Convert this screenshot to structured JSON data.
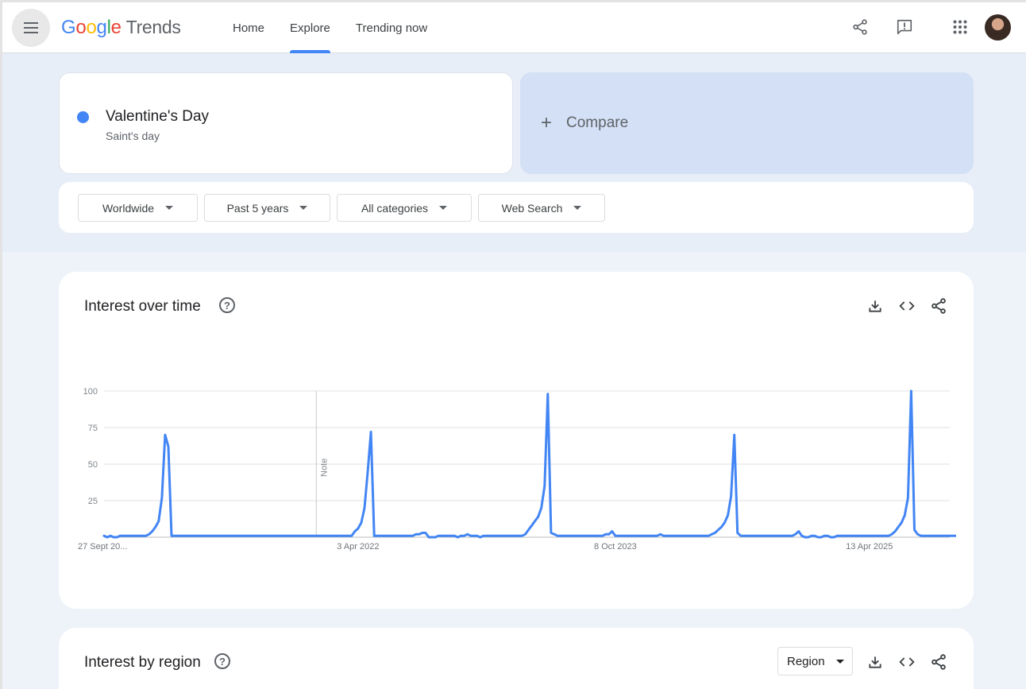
{
  "header": {
    "logo_google": [
      "G",
      "o",
      "o",
      "g",
      "l",
      "e"
    ],
    "logo_trends": "Trends",
    "nav": [
      {
        "label": "Home",
        "active": false
      },
      {
        "label": "Explore",
        "active": true
      },
      {
        "label": "Trending now",
        "active": false
      }
    ]
  },
  "search": {
    "term": "Valentine's Day",
    "term_type": "Saint's day",
    "term_color": "#4285f4",
    "compare_plus": "+",
    "compare_label": "Compare"
  },
  "filters": [
    {
      "label": "Worldwide"
    },
    {
      "label": "Past 5 years"
    },
    {
      "label": "All categories"
    },
    {
      "label": "Web Search"
    }
  ],
  "interest_over_time": {
    "title": "Interest over time",
    "help": "?"
  },
  "interest_by_region": {
    "title": "Interest by region",
    "help": "?",
    "resolution": "Region"
  },
  "chart_data": {
    "type": "line",
    "series_color": "#4285f4",
    "ylim": [
      0,
      100
    ],
    "y_ticks": [
      100,
      75,
      50,
      25
    ],
    "x_tick_labels": [
      "27 Sept 20...",
      "3 Apr 2022",
      "8 Oct 2023",
      "13 Apr 2025"
    ],
    "x_tick_weeks": [
      0,
      79,
      159,
      238
    ],
    "annotation": {
      "label": "Note",
      "week": 66
    },
    "grid": true,
    "total_weeks": 264,
    "values": [
      1,
      0,
      1,
      0,
      0,
      1,
      1,
      1,
      1,
      1,
      1,
      1,
      1,
      1,
      2,
      4,
      7,
      11,
      27,
      70,
      62,
      1,
      1,
      1,
      1,
      1,
      1,
      1,
      1,
      1,
      1,
      1,
      1,
      1,
      1,
      1,
      1,
      1,
      1,
      1,
      1,
      1,
      1,
      1,
      1,
      1,
      1,
      1,
      1,
      1,
      1,
      1,
      1,
      1,
      1,
      1,
      1,
      1,
      1,
      1,
      1,
      1,
      1,
      1,
      1,
      1,
      1,
      1,
      1,
      1,
      1,
      1,
      1,
      1,
      1,
      1,
      1,
      1,
      4,
      6,
      10,
      20,
      45,
      72,
      1,
      1,
      1,
      1,
      1,
      1,
      1,
      1,
      1,
      1,
      1,
      1,
      1,
      2,
      2,
      3,
      3,
      0,
      0,
      0,
      1,
      1,
      1,
      1,
      1,
      1,
      0,
      1,
      1,
      2,
      1,
      1,
      1,
      0,
      1,
      1,
      1,
      1,
      1,
      1,
      1,
      1,
      1,
      1,
      1,
      1,
      1,
      2,
      5,
      8,
      11,
      14,
      20,
      35,
      98,
      3,
      2,
      1,
      1,
      1,
      1,
      1,
      1,
      1,
      1,
      1,
      1,
      1,
      1,
      1,
      1,
      1,
      2,
      2,
      4,
      1,
      1,
      1,
      1,
      1,
      1,
      1,
      1,
      1,
      1,
      1,
      1,
      1,
      1,
      2,
      1,
      1,
      1,
      1,
      1,
      1,
      1,
      1,
      1,
      1,
      1,
      1,
      1,
      1,
      1,
      2,
      3,
      5,
      7,
      10,
      15,
      28,
      70,
      3,
      1,
      1,
      1,
      1,
      1,
      1,
      1,
      1,
      1,
      1,
      1,
      1,
      1,
      1,
      1,
      1,
      1,
      2,
      4,
      1,
      0,
      0,
      1,
      1,
      0,
      0,
      1,
      1,
      0,
      0,
      1,
      1,
      1,
      1,
      1,
      1,
      1,
      1,
      1,
      1,
      1,
      1,
      1,
      1,
      1,
      1,
      1,
      2,
      4,
      7,
      10,
      15,
      27,
      100,
      5,
      2,
      1,
      1,
      1,
      1,
      1,
      1,
      1,
      1,
      1,
      1,
      1,
      1,
      1,
      1,
      2,
      5,
      1,
      1,
      0,
      1,
      1,
      1,
      1,
      1,
      1,
      1,
      1,
      1,
      1,
      1,
      1,
      0
    ]
  }
}
